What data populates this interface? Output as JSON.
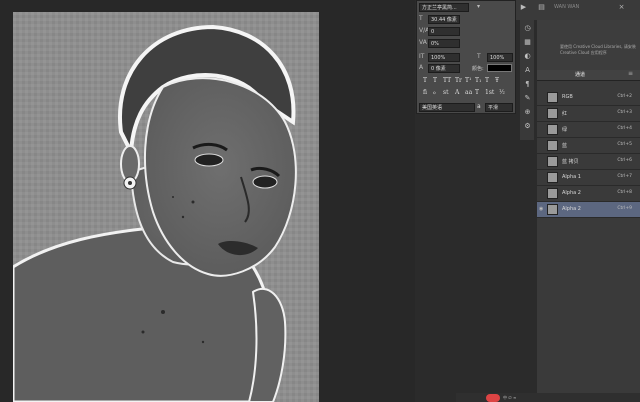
{
  "character_panel": {
    "font_family": "方正兰亭黑简...",
    "font_size": "30.44 像素",
    "kerning": "0",
    "tracking": "0%",
    "vscale": "100%",
    "hscale": "100%",
    "baseline": "0 像素",
    "color_label": "颜色:",
    "language": "美国英语",
    "aa": "a",
    "aa_mode": "平滑",
    "type_buttons": [
      "T",
      "T",
      "TT",
      "Tr",
      "T¹",
      "T₁",
      "T",
      "Ŧ"
    ],
    "ot_buttons": [
      "fi",
      "ℴ",
      "st",
      "A",
      "aa",
      "T",
      "1st",
      "½"
    ]
  },
  "libraries": {
    "text": "要使用 Creative Cloud Libraries, 请安装 Creative Cloud 应用程序"
  },
  "channels_panel": {
    "tab_label": "通道",
    "menu_icon": "≡",
    "rows": [
      {
        "name": "RGB",
        "shortcut": "Ctrl+2",
        "selected": false,
        "visible": false
      },
      {
        "name": "红",
        "shortcut": "Ctrl+3",
        "selected": false,
        "visible": false
      },
      {
        "name": "绿",
        "shortcut": "Ctrl+4",
        "selected": false,
        "visible": false
      },
      {
        "name": "蓝",
        "shortcut": "Ctrl+5",
        "selected": false,
        "visible": false
      },
      {
        "name": "蓝 拷贝",
        "shortcut": "Ctrl+6",
        "selected": false,
        "visible": false
      },
      {
        "name": "Alpha 1",
        "shortcut": "Ctrl+7",
        "selected": false,
        "visible": false
      },
      {
        "name": "Alpha 2",
        "shortcut": "Ctrl+8",
        "selected": false,
        "visible": false
      },
      {
        "name": "Alpha 2",
        "shortcut": "Ctrl+9",
        "selected": true,
        "visible": true
      }
    ]
  },
  "watermark_top": "WAN WAN",
  "status": {
    "pip_label": "中 ∅ ∞"
  }
}
